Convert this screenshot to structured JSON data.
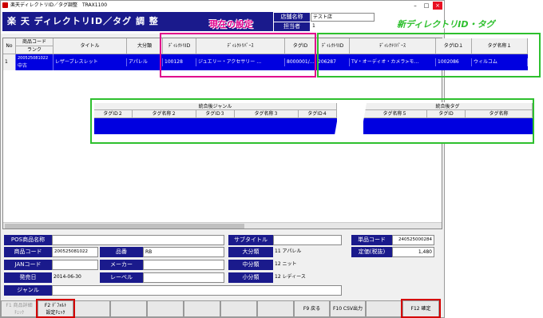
{
  "window": {
    "title": "楽天ディレクトリID／タグ調整　TRAX1100"
  },
  "app": {
    "title": "楽 天 ディレクトリID／タグ 調 整",
    "shop_label": "店舗名称",
    "shop_value": "テスト店",
    "staff_label": "担当者",
    "staff_value": "1"
  },
  "callouts": {
    "current": "現在の設定",
    "new": "新ディレクトリID・タグ"
  },
  "main_grid": {
    "headers": {
      "no": "No",
      "code": "商品コード",
      "rank": "ランク",
      "title": "タイトル",
      "major": "大分類",
      "dir_id": "ﾃﾞｨﾚｸﾄﾘID",
      "dir_path": "ﾃﾞｨﾚｸﾄﾘﾊﾟｰｽ",
      "tag_id": "タグID",
      "new_dir_id": "ﾃﾞｨﾚｸﾄﾘID",
      "new_dir_path": "ﾃﾞｨﾚｸﾄﾘﾊﾟｰｽ",
      "tag_id1": "タグID１",
      "tag_name1": "タグ名称１"
    },
    "row": {
      "no": "1",
      "code": "200525081022",
      "rank": "中古",
      "title": "レザーブレスレット",
      "major": "アパレル",
      "dir_id": "100128",
      "dir_path": "ジュエリー・アクセサリー …",
      "tag_id": "8000001/…",
      "new_dir_id": "206287",
      "new_dir_path": "TV・オーディオ・カメラ>モ…",
      "tag_id1": "1002086",
      "tag_name1": "ウィルコム"
    }
  },
  "sub_grid": {
    "group1": "統合後ジャンル",
    "group2": "統合後タグ",
    "cols": [
      "タグID２",
      "タグ名称２",
      "タグID３",
      "タグ名称３",
      "タグID４",
      "タグ名称５",
      "タグID",
      "タグ名称"
    ]
  },
  "detail": {
    "pos_name_label": "POS商品名称",
    "pos_name_value": "",
    "subtitle_label": "サブタイトル",
    "subtitle_value": "",
    "product_code_label": "商品コード",
    "product_code_value": "200525081022",
    "part_no_label": "品番",
    "part_no_value": "RB",
    "jan_label": "JANコード",
    "jan_value": "",
    "maker_label": "メーカー",
    "maker_value": "",
    "release_label": "発売日",
    "release_value": "2014-06-30",
    "label_label": "レーベル",
    "label_value": "",
    "genre_label": "ジャンル",
    "genre_value": "",
    "major_label": "大分類",
    "major_value": "11 アパレル",
    "mid_label": "中分類",
    "mid_value": "12 ニット",
    "minor_label": "小分類",
    "minor_value": "12 レディース",
    "unit_code_label": "単品コード",
    "unit_code_value": "240525000284",
    "price_label": "定価(税抜)",
    "price_value": "1,480"
  },
  "fkeys": {
    "f1": "F1 商品詳細\nﾁｪｯｸ",
    "f2": "F2 ﾃﾞﾌｫﾙﾄ\n設定ﾁｪｯｸ",
    "f9": "F9 戻る",
    "f10": "F10 CSV出力",
    "f12": "F12 確定"
  }
}
